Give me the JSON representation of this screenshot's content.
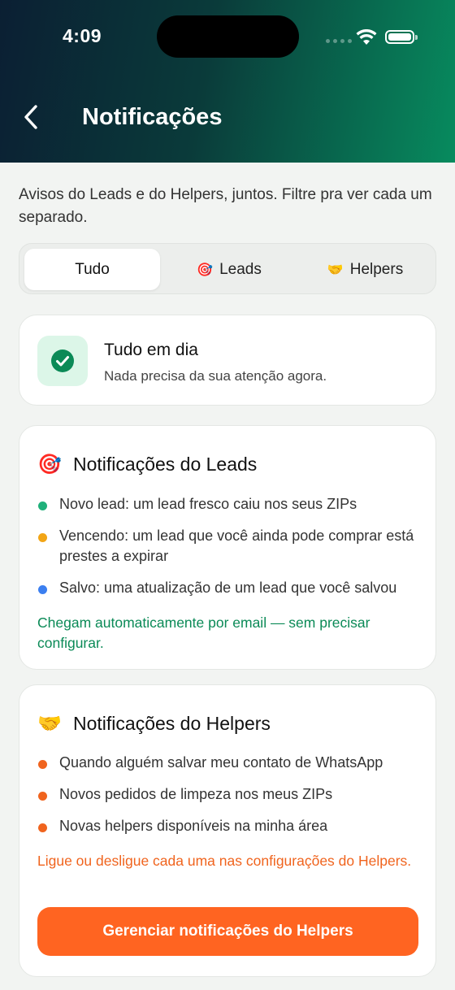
{
  "status": {
    "time": "4:09"
  },
  "header": {
    "title": "Notificações"
  },
  "subtitle": "Avisos do Leads e do Helpers, juntos. Filtre pra ver cada um separado.",
  "tabs": [
    {
      "label": "Tudo",
      "emoji": "",
      "active": true
    },
    {
      "label": "Leads",
      "emoji": "🎯",
      "active": false
    },
    {
      "label": "Helpers",
      "emoji": "🤝",
      "active": false
    }
  ],
  "status_card": {
    "title": "Tudo em dia",
    "subtitle": "Nada precisa da sua atenção agora."
  },
  "leads_section": {
    "emoji": "🎯",
    "title": "Notificações do Leads",
    "items": [
      {
        "text": "Novo lead: um lead fresco caiu nos seus ZIPs",
        "color": "#1fb07a"
      },
      {
        "text": "Vencendo: um lead que você ainda pode comprar está prestes a expirar",
        "color": "#f2a516"
      },
      {
        "text": "Salvo: uma atualização de um lead que você salvou",
        "color": "#3b7ff0"
      }
    ],
    "note": "Chegam automaticamente por email — sem precisar configurar."
  },
  "helpers_section": {
    "emoji": "🤝",
    "title": "Notificações do Helpers",
    "items": [
      {
        "text": "Quando alguém salvar meu contato de WhatsApp",
        "color": "#f0641e"
      },
      {
        "text": "Novos pedidos de limpeza nos meus ZIPs",
        "color": "#f0641e"
      },
      {
        "text": "Novas helpers disponíveis na minha área",
        "color": "#f0641e"
      }
    ],
    "note": "Ligue ou desligue cada uma nas configurações do Helpers.",
    "button_label": "Gerenciar notificações do Helpers"
  },
  "colors": {
    "accent_green": "#0b8a57",
    "accent_orange": "#ff6421"
  }
}
